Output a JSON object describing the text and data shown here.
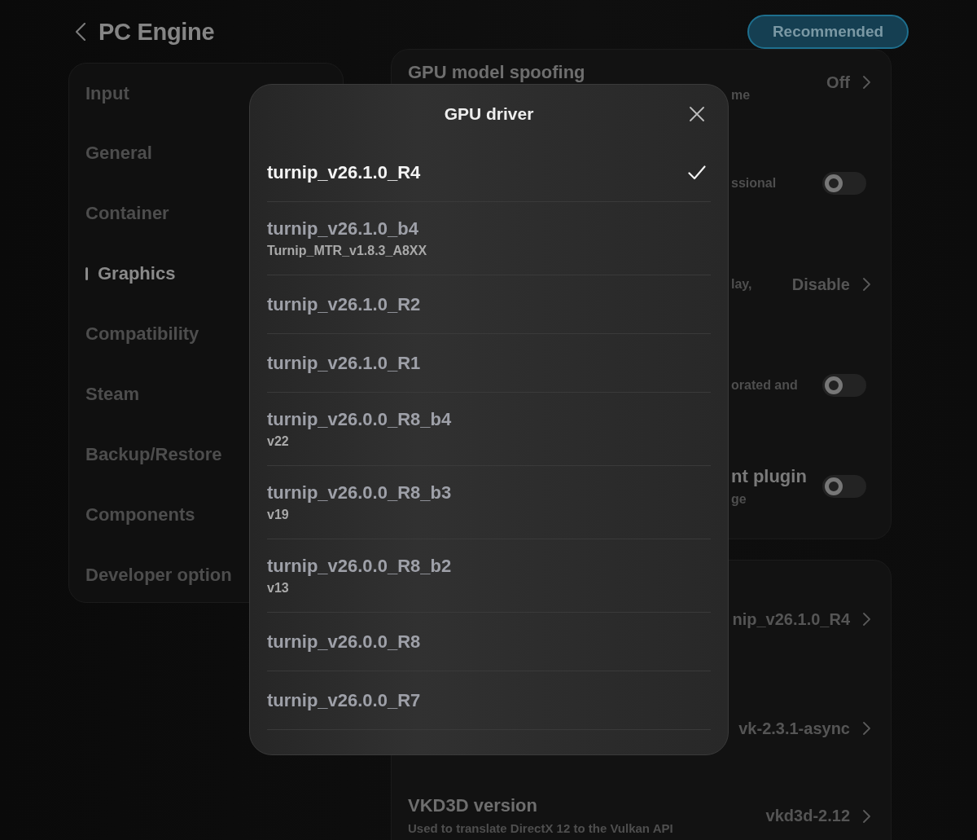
{
  "header": {
    "title": "PC Engine",
    "button": "Recommended"
  },
  "sidebar": {
    "items": [
      {
        "label": "Input",
        "selected": false
      },
      {
        "label": "General",
        "selected": false
      },
      {
        "label": "Container",
        "selected": false
      },
      {
        "label": "Graphics",
        "selected": true
      },
      {
        "label": "Compatibility",
        "selected": false
      },
      {
        "label": "Steam",
        "selected": false
      },
      {
        "label": "Backup/Restore",
        "selected": false
      },
      {
        "label": "Components",
        "selected": false
      },
      {
        "label": "Developer option",
        "selected": false
      }
    ]
  },
  "settings": {
    "cards": [
      {
        "rows": [
          {
            "kind": "value",
            "title": "GPU model spoofing",
            "description": "me",
            "value": "Off"
          },
          {
            "kind": "toggle",
            "description": "ssional",
            "on": false
          },
          {
            "kind": "value",
            "description": "lay,",
            "value": "Disable"
          },
          {
            "kind": "toggle",
            "description": "orated and",
            "on": false
          },
          {
            "kind": "toggle",
            "title": "nt plugin",
            "description": "ge",
            "on": false
          }
        ]
      },
      {
        "rows": [
          {
            "kind": "value",
            "value": "nip_v26.1.0_R4"
          },
          {
            "kind": "value",
            "value": "vk-2.3.1-async"
          },
          {
            "kind": "value",
            "title": "VKD3D version",
            "description": "Used to translate DirectX 12 to the Vulkan API",
            "value": "vkd3d-2.12"
          }
        ]
      }
    ]
  },
  "dialog": {
    "title": "GPU driver",
    "items": [
      {
        "label": "turnip_v26.1.0_R4",
        "selected": true
      },
      {
        "label": "turnip_v26.1.0_b4",
        "sublabel": "Turnip_MTR_v1.8.3_A8XX",
        "selected": false
      },
      {
        "label": "turnip_v26.1.0_R2",
        "selected": false
      },
      {
        "label": "turnip_v26.1.0_R1",
        "selected": false
      },
      {
        "label": "turnip_v26.0.0_R8_b4",
        "sublabel": "v22",
        "selected": false
      },
      {
        "label": "turnip_v26.0.0_R8_b3",
        "sublabel": "v19",
        "selected": false
      },
      {
        "label": "turnip_v26.0.0_R8_b2",
        "sublabel": "v13",
        "selected": false
      },
      {
        "label": "turnip_v26.0.0_R8",
        "selected": false
      },
      {
        "label": "turnip_v26.0.0_R7",
        "selected": false
      }
    ]
  }
}
